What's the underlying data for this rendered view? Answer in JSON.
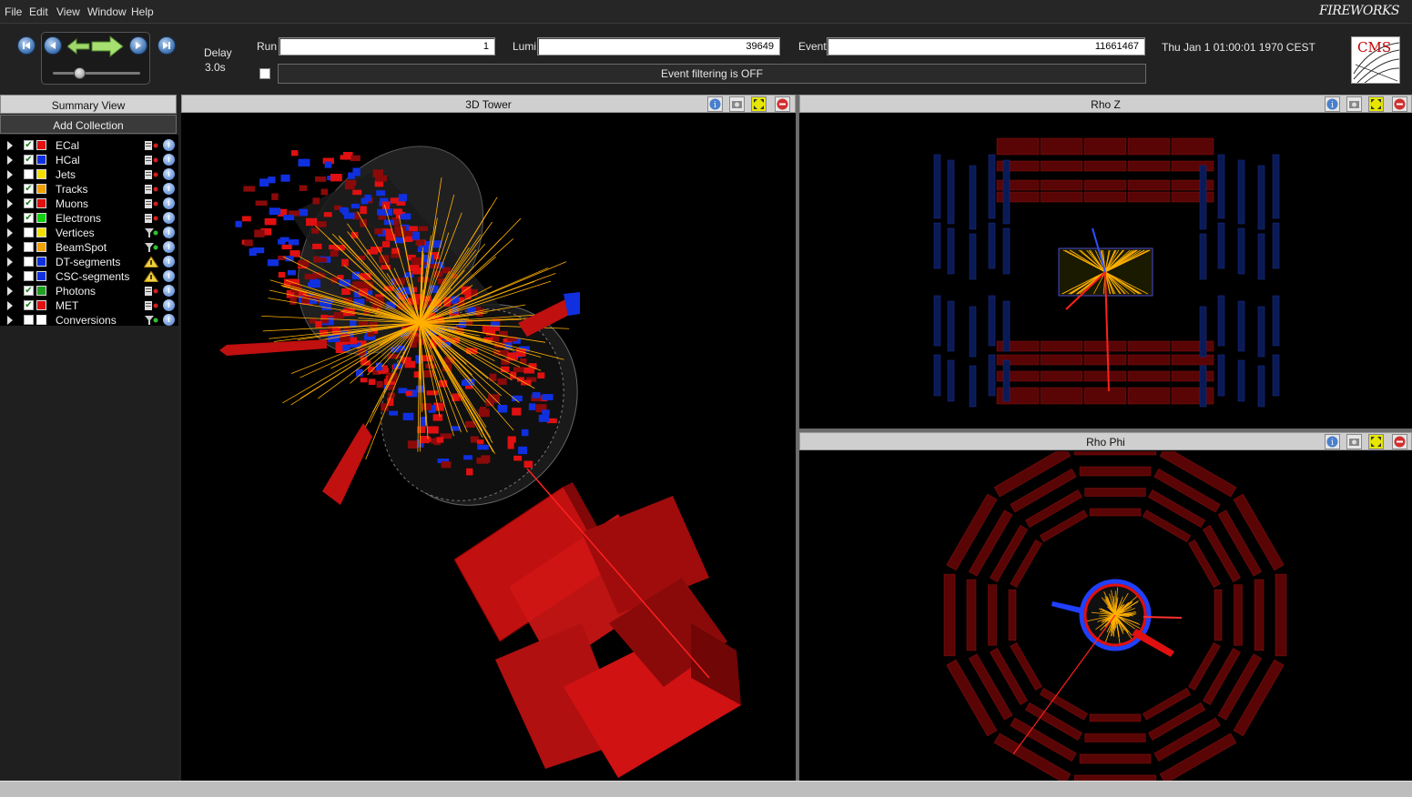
{
  "menu": {
    "file": "File",
    "edit": "Edit",
    "view": "View",
    "window": "Window",
    "help": "Help"
  },
  "brand": "FIREWORKS",
  "toolbar": {
    "delay_label": "Delay",
    "delay_value": "3.0s",
    "run_label": "Run",
    "run_value": "1",
    "lumi_label": "Lumi",
    "lumi_value": "39649",
    "event_label": "Event",
    "event_value": "11661467",
    "timestamp": "Thu Jan  1 01:00:01 1970 CEST",
    "filter_status": "Event filtering is OFF",
    "logo_text": "CMS"
  },
  "left_panel": {
    "summary_tab": "Summary View",
    "add_collection": "Add Collection",
    "collections": [
      {
        "name": "ECal",
        "visible": true,
        "color": "#e01010",
        "filter": "filter-icon"
      },
      {
        "name": "HCal",
        "visible": true,
        "color": "#1030e0",
        "filter": "filter-icon"
      },
      {
        "name": "Jets",
        "visible": false,
        "color": "#f0e000",
        "filter": "filter-icon"
      },
      {
        "name": "Tracks",
        "visible": true,
        "color": "#f0a000",
        "filter": "filter-icon"
      },
      {
        "name": "Muons",
        "visible": true,
        "color": "#e01010",
        "filter": "filter-icon"
      },
      {
        "name": "Electrons",
        "visible": true,
        "color": "#10d010",
        "filter": "filter-icon"
      },
      {
        "name": "Vertices",
        "visible": false,
        "color": "#f0e000",
        "filter": "funnel-icon"
      },
      {
        "name": "BeamSpot",
        "visible": false,
        "color": "#f0a000",
        "filter": "funnel-icon"
      },
      {
        "name": "DT-segments",
        "visible": false,
        "color": "#1030e0",
        "filter": "warning-icon"
      },
      {
        "name": "CSC-segments",
        "visible": false,
        "color": "#1030e0",
        "filter": "warning-icon"
      },
      {
        "name": "Photons",
        "visible": true,
        "color": "#20a020",
        "filter": "filter-icon"
      },
      {
        "name": "MET",
        "visible": true,
        "color": "#e01010",
        "filter": "filter-icon"
      },
      {
        "name": "Conversions",
        "visible": false,
        "color": "#ffffff",
        "filter": "funnel-icon"
      }
    ]
  },
  "views": {
    "tower3d": {
      "title": "3D Tower"
    },
    "rhoz": {
      "title": "Rho Z"
    },
    "rhophi": {
      "title": "Rho Phi"
    }
  },
  "colors": {
    "ecal": "#e01010",
    "hcal": "#1030e0",
    "tracks": "#ffb000",
    "muon_station": "#5a0505",
    "muon_chamber_blue": "#0a1a55"
  }
}
